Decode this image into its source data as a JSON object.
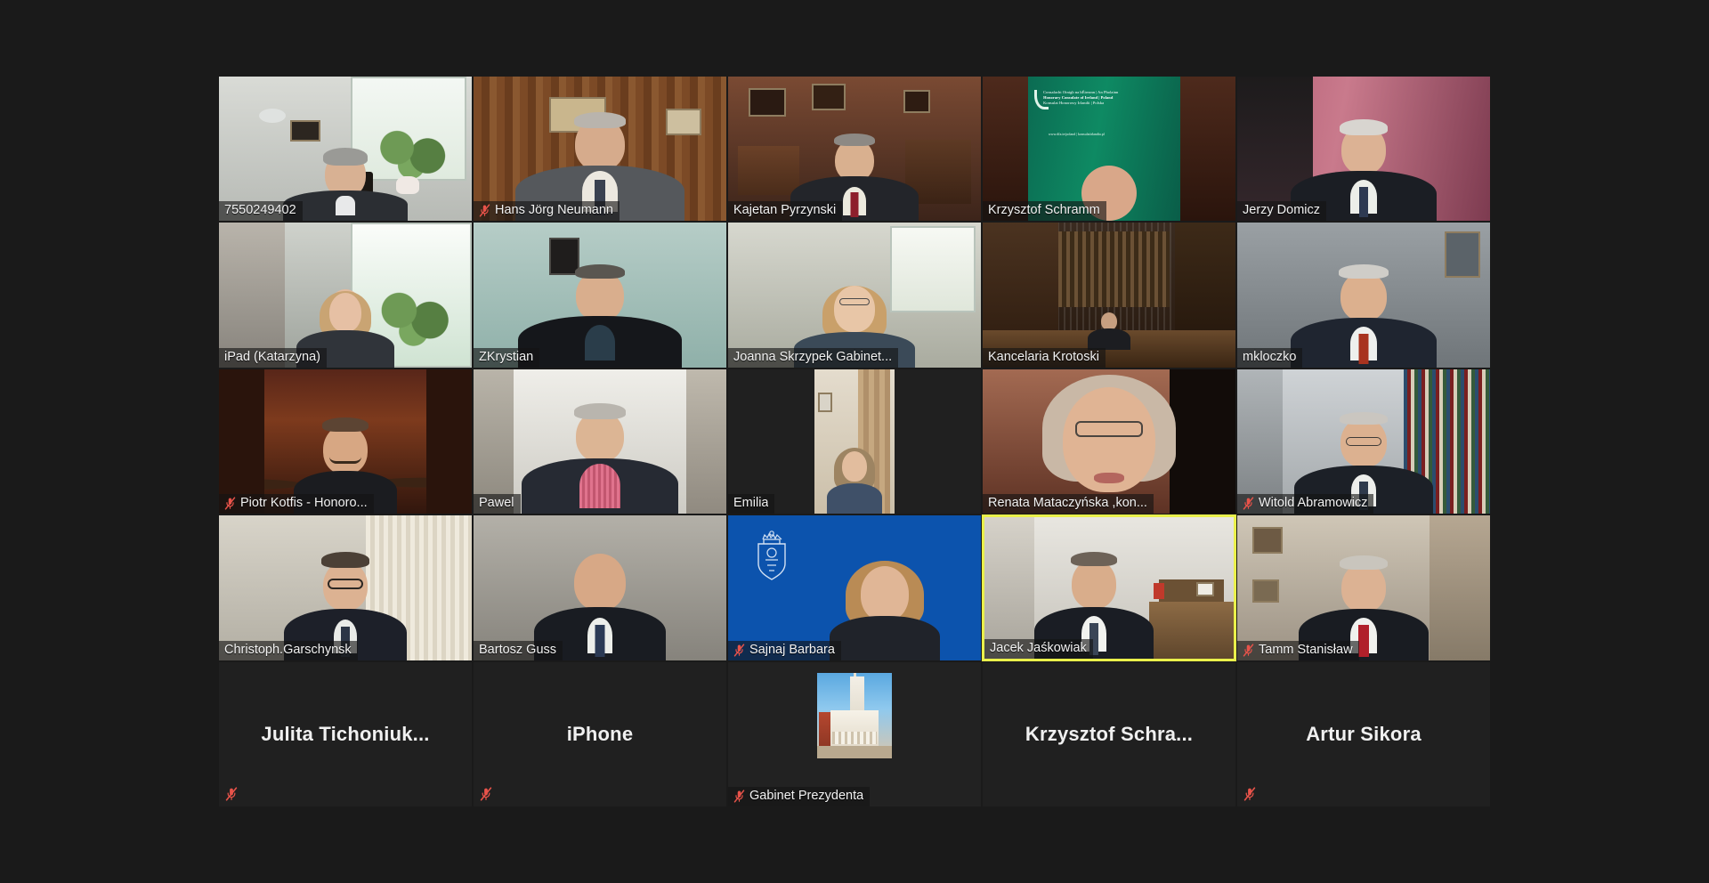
{
  "app": {
    "name": "Zoom Meeting",
    "view": "Gallery View",
    "background_color": "#1a1a1a",
    "active_speaker_border_color": "#eaf04b",
    "muted_icon_color": "#e8534a",
    "label_text_color": "#f2f2f2"
  },
  "grid": {
    "columns": 5,
    "rows": 5,
    "total_participants": 25
  },
  "participants": [
    {
      "id": "p1",
      "name": "7550249402",
      "muted": false,
      "video_on": true,
      "active_speaker": false,
      "row": 1,
      "col": 1,
      "scene": "office-window-clock"
    },
    {
      "id": "p2",
      "name": "Hans Jörg Neumann",
      "muted": true,
      "video_on": true,
      "active_speaker": false,
      "row": 1,
      "col": 2,
      "scene": "wood-office-suit"
    },
    {
      "id": "p3",
      "name": "Kajetan Pyrzynski",
      "muted": false,
      "video_on": true,
      "active_speaker": false,
      "row": 1,
      "col": 3,
      "scene": "study-frames"
    },
    {
      "id": "p4",
      "name": "Krzysztof Schramm",
      "muted": false,
      "video_on": true,
      "active_speaker": false,
      "row": 1,
      "col": 4,
      "scene": "irish-consulate-banner"
    },
    {
      "id": "p5",
      "name": "Jerzy Domicz",
      "muted": false,
      "video_on": true,
      "active_speaker": false,
      "row": 1,
      "col": 5,
      "scene": "pink-curtain-suit"
    },
    {
      "id": "p6",
      "name": "iPad (Katarzyna)",
      "muted": false,
      "video_on": true,
      "active_speaker": false,
      "row": 2,
      "col": 1,
      "scene": "bright-window-woman"
    },
    {
      "id": "p7",
      "name": "ZKrystian",
      "muted": false,
      "video_on": true,
      "active_speaker": false,
      "row": 2,
      "col": 2,
      "scene": "teal-room-man"
    },
    {
      "id": "p8",
      "name": "Joanna Skrzypek Gabinet...",
      "muted": false,
      "video_on": true,
      "active_speaker": false,
      "row": 2,
      "col": 3,
      "scene": "light-room-woman-glasses"
    },
    {
      "id": "p9",
      "name": "Kancelaria Krotoski",
      "muted": false,
      "video_on": true,
      "active_speaker": false,
      "row": 2,
      "col": 4,
      "scene": "dark-library-desk"
    },
    {
      "id": "p10",
      "name": "mkloczko",
      "muted": false,
      "video_on": true,
      "active_speaker": false,
      "row": 2,
      "col": 5,
      "scene": "grey-room-man-tie"
    },
    {
      "id": "p11",
      "name": "Piotr Kotfis - Honoro...",
      "muted": true,
      "video_on": true,
      "active_speaker": false,
      "row": 3,
      "col": 1,
      "scene": "fireplace-bald-man"
    },
    {
      "id": "p12",
      "name": "Pawel",
      "muted": false,
      "video_on": true,
      "active_speaker": false,
      "row": 3,
      "col": 2,
      "scene": "white-room-pink-scarf"
    },
    {
      "id": "p13",
      "name": "Emilia",
      "muted": false,
      "video_on": true,
      "active_speaker": false,
      "row": 3,
      "col": 3,
      "scene": "portrait-letterbox-woman"
    },
    {
      "id": "p14",
      "name": "Renata Mataczyńska ,kon...",
      "muted": false,
      "video_on": true,
      "active_speaker": false,
      "row": 3,
      "col": 4,
      "scene": "closeup-woman-glasses"
    },
    {
      "id": "p15",
      "name": "Witold Abramowicz",
      "muted": true,
      "video_on": true,
      "active_speaker": false,
      "row": 3,
      "col": 5,
      "scene": "bookshelf-man-glasses"
    },
    {
      "id": "p16",
      "name": "Christoph.Garschynsk",
      "muted": false,
      "video_on": true,
      "active_speaker": false,
      "row": 4,
      "col": 1,
      "scene": "blinds-man-glasses"
    },
    {
      "id": "p17",
      "name": "Bartosz Guss",
      "muted": false,
      "video_on": true,
      "active_speaker": false,
      "row": 4,
      "col": 2,
      "scene": "grey-wall-bald-man"
    },
    {
      "id": "p18",
      "name": "Sajnaj Barbara",
      "muted": true,
      "video_on": true,
      "active_speaker": false,
      "row": 4,
      "col": 3,
      "scene": "blue-crest-backdrop"
    },
    {
      "id": "p19",
      "name": "Jacek Jaśkowiak",
      "muted": false,
      "video_on": true,
      "active_speaker": true,
      "row": 4,
      "col": 4,
      "scene": "office-shelf-man"
    },
    {
      "id": "p20",
      "name": "Tamm Stanisław",
      "muted": true,
      "video_on": true,
      "active_speaker": false,
      "row": 4,
      "col": 5,
      "scene": "home-red-tie-man"
    },
    {
      "id": "p21",
      "name": "Julita  Tichoniuk...",
      "muted": true,
      "video_on": false,
      "active_speaker": false,
      "row": 5,
      "col": 1,
      "scene": "none"
    },
    {
      "id": "p22",
      "name": "iPhone",
      "muted": true,
      "video_on": false,
      "active_speaker": false,
      "row": 5,
      "col": 2,
      "scene": "none"
    },
    {
      "id": "p23",
      "name": "Gabinet Prezydenta",
      "muted": true,
      "video_on": true,
      "active_speaker": false,
      "row": 5,
      "col": 3,
      "scene": "city-hall-photo"
    },
    {
      "id": "p24",
      "name": "Krzysztof  Schra...",
      "muted": false,
      "video_on": false,
      "active_speaker": false,
      "row": 5,
      "col": 4,
      "scene": "none"
    },
    {
      "id": "p25",
      "name": "Artur Sikora",
      "muted": true,
      "video_on": false,
      "active_speaker": false,
      "row": 5,
      "col": 5,
      "scene": "none"
    }
  ],
  "banner": {
    "line1": "Consalacht Oinigh na hÉireann | An Pholainn",
    "line2": "Honorary Consulate of Ireland | Poland",
    "line3": "Konsulat Honorowy Irlandii | Polska",
    "url": "www.dfa.ie/poland    |    konsulatirlandia.pl"
  }
}
